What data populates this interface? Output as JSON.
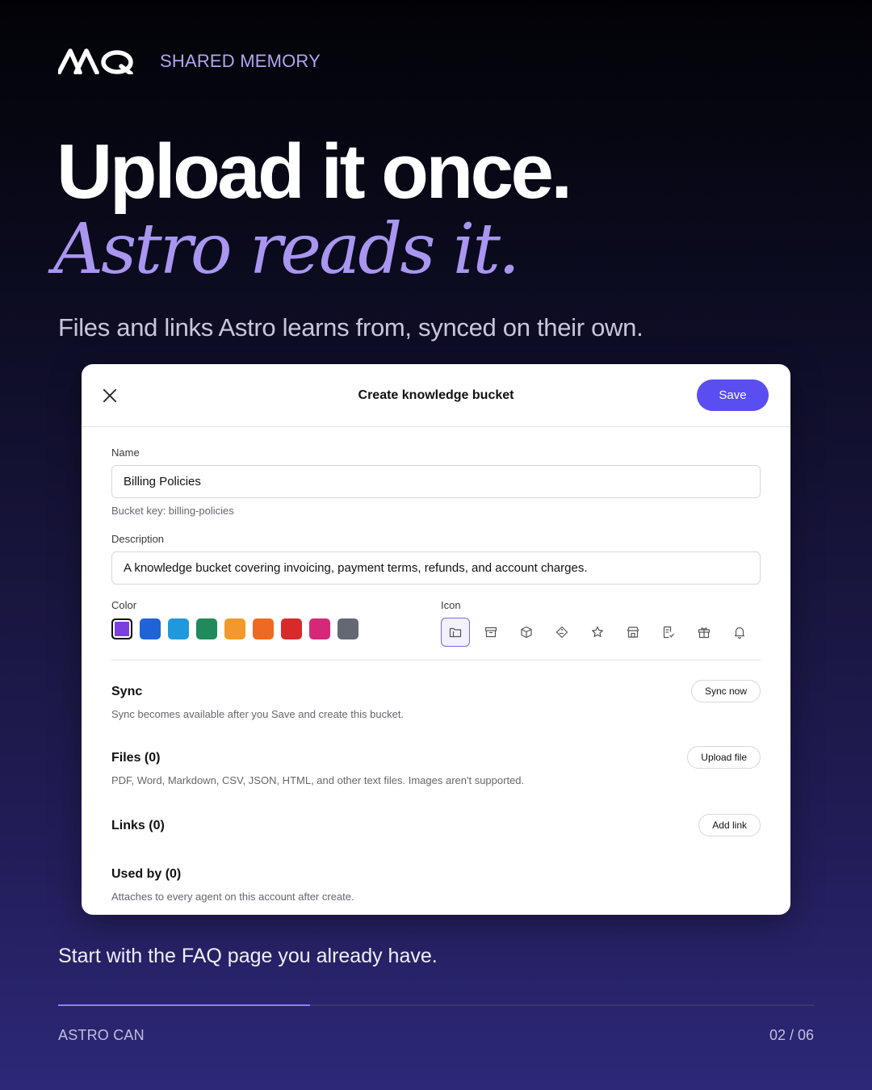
{
  "brand": {
    "label": "SHARED MEMORY"
  },
  "headline": {
    "line1": "Upload it once.",
    "line2": "Astro reads it.",
    "subtitle": "Files and links Astro learns from, synced on their own."
  },
  "dialog": {
    "title": "Create knowledge bucket",
    "save_label": "Save",
    "name": {
      "label": "Name",
      "value": "Billing Policies",
      "helper": "Bucket key: billing-policies"
    },
    "description": {
      "label": "Description",
      "value": "A knowledge bucket covering invoicing, payment terms, refunds, and account charges."
    },
    "color": {
      "label": "Color",
      "swatches": [
        "#7b3fe0",
        "#1f63d6",
        "#1f99db",
        "#1f8a5c",
        "#f19a2b",
        "#ef6a21",
        "#d82a2a",
        "#d6287a",
        "#646872"
      ],
      "selected_index": 0
    },
    "icon": {
      "label": "Icon",
      "icons": [
        "folder-icon",
        "archive-icon",
        "cube-icon",
        "tag-icon",
        "star-icon",
        "store-icon",
        "checklist-icon",
        "gift-icon",
        "bell-icon"
      ],
      "selected_index": 0
    },
    "sync": {
      "title": "Sync",
      "description": "Sync becomes available after you Save and create this bucket.",
      "button": "Sync now"
    },
    "files": {
      "title": "Files (0)",
      "description": "PDF, Word, Markdown, CSV, JSON, HTML, and other text files. Images aren't supported.",
      "button": "Upload file"
    },
    "links": {
      "title": "Links (0)",
      "button": "Add link"
    },
    "used_by": {
      "title": "Used by (0)",
      "description": "Attaches to every agent on this account after create."
    }
  },
  "footer": {
    "tagline": "Start with the FAQ page you already have.",
    "left_label": "ASTRO CAN",
    "page_indicator": "02 / 06",
    "progress": 0.333
  }
}
